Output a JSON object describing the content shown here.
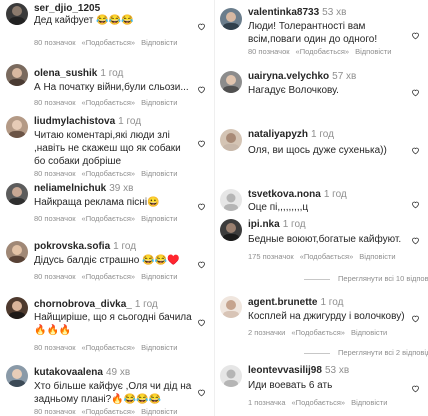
{
  "left": [
    {
      "user": "ser_djio_1205",
      "time": "",
      "text": "Дед кайфует 😂😂😂",
      "likes": "80 позначок",
      "reply": "«Подобається»",
      "answer": "Відповісти"
    },
    {
      "user": "olena_sushik",
      "time": "1 год",
      "text": "А На початку війни,були сльози...",
      "likes": "80 позначок",
      "reply": "«Подобається»",
      "answer": "Відповісти"
    },
    {
      "user": "liudmylachistova",
      "time": "1 год",
      "text": "Читаю коментарі,які люди злі ,навіть не скажеш що як собаки бо собаки добріше",
      "likes": "80 позначок",
      "reply": "«Подобається»",
      "answer": "Відповісти"
    },
    {
      "user": "neliamelnichuk",
      "time": "39 хв",
      "text": "Найкраща реклама пісні😀",
      "likes": "80 позначок",
      "reply": "«Подобається»",
      "answer": "Відповісти"
    },
    {
      "user": "pokrovska.sofia",
      "time": "1 год",
      "text": "Дідусь балдіє страшно 😂😂♥️",
      "likes": "80 позначок",
      "reply": "«Подобається»",
      "answer": "Відповісти"
    },
    {
      "user": "chornobrova_divka_",
      "time": "1 год",
      "text": "Найщиріше, що я сьогодні бачила 🔥🔥🔥",
      "likes": "80 позначок",
      "reply": "«Подобається»",
      "answer": "Відповісти"
    },
    {
      "user": "kutakovaalena",
      "time": "49 хв",
      "text": "Хто більше кайфує ,Оля чи дід на задньому плані?🔥😂😂😂",
      "likes": "80 позначок",
      "reply": "«Подобається»",
      "answer": "Відповісти"
    }
  ],
  "right": [
    {
      "user": "valentinka8733",
      "time": "53 хв",
      "text": "Люди! Толерантності вам всім,поваги один до одного!",
      "likes": "80 позначок",
      "reply": "«Подобається»",
      "answer": "Відповісти"
    },
    {
      "user": "uairyna.velychko",
      "time": "57 хв",
      "text": "Нагадує Волочкову.",
      "likes": "",
      "reply": "",
      "answer": ""
    },
    {
      "user": "nataliyapyzh",
      "time": "1 год",
      "text": "Оля, ви щось дуже сухенька))",
      "likes": "",
      "reply": "",
      "answer": ""
    },
    {
      "user": "tsvetkova.nona",
      "time": "1 год",
      "text": "Оце пі,,,,,,,,,ц",
      "likes": "",
      "reply": "",
      "answer": ""
    },
    {
      "user": "ipi.nka",
      "time": "1 год",
      "text": "Бедные воюют,богатые кайфуют.",
      "likes": "175 позначок",
      "reply": "«Подобається»",
      "answer": "Відповісти"
    },
    {
      "user": "agent.brunette",
      "time": "1 год",
      "text": "Косплей на джигурду і волочкову)",
      "likes": "2 позначки",
      "reply": "«Подобається»",
      "answer": "Відповісти"
    },
    {
      "user": "leontevvasilij98",
      "time": "53 хв",
      "text": "Иди воевать 6 ать",
      "likes": "1 позначка",
      "reply": "«Подобається»",
      "answer": "Відповісти"
    }
  ],
  "replies": {
    "ipi": "Переглянути всі 10 відповідей",
    "agent": "Переглянути всі 2 відповіді"
  },
  "colors": {
    "username": "#262626",
    "muted": "#8e8e8e",
    "heart": "#262626",
    "background": "#ffffff"
  }
}
